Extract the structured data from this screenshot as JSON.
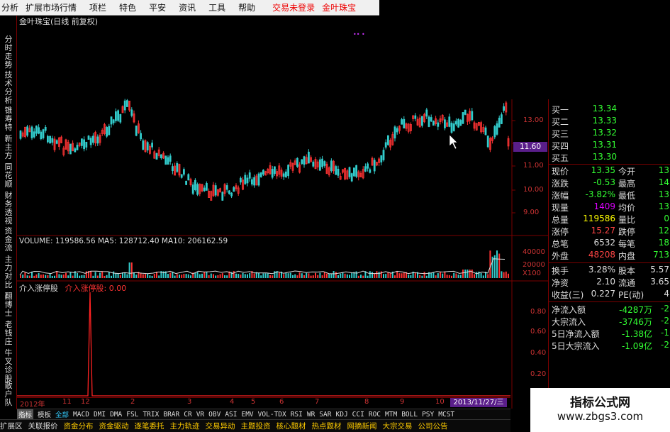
{
  "menu": {
    "items": [
      "分析",
      "扩展市场行情",
      "项栏",
      "特色",
      "平安",
      "资讯",
      "工具",
      "帮助"
    ],
    "login_status": "交易未登录",
    "stock_name": "金叶珠宝"
  },
  "chart": {
    "title": "金叶珠宝(日线 前复权)",
    "price_flag": "11.60",
    "price_ticks": [
      "13.00",
      "12.00",
      "11.00",
      "10.00",
      "9.00"
    ],
    "volume_label": "VOLUME: 119586.56  MA5: 128712.40  MA10: 206162.59",
    "volume_ticks": [
      "40000",
      "20000",
      "X100"
    ],
    "indicator_name": "介入涨停股",
    "indicator_value": "介入涨停股: 0.00",
    "indicator_ticks": [
      "0.80",
      "0.60",
      "0.40",
      "0.20"
    ],
    "date_badge": "2013/11/27/三",
    "x_ticks": [
      "2012年",
      "11",
      "12",
      "2",
      "3",
      "4",
      "5",
      "6",
      "7",
      "8",
      "9",
      "10",
      "11"
    ]
  },
  "left_tabs": [
    "分时走势",
    "技术分析",
    "锥寿特",
    "新主方",
    "同花顺",
    "财务透视",
    "资金流",
    "主力对比",
    "翻博士",
    "老钱庄",
    "牛叉诊股",
    "散户队"
  ],
  "quote": {
    "bids": [
      {
        "label": "买一",
        "value": "13.34"
      },
      {
        "label": "买二",
        "value": "13.33"
      },
      {
        "label": "买三",
        "value": "13.32"
      },
      {
        "label": "买四",
        "value": "13.31"
      },
      {
        "label": "买五",
        "value": "13.30"
      }
    ],
    "stats": [
      {
        "l1": "现价",
        "v1": "13.35",
        "c1": "#3f3",
        "l2": "今开",
        "v2": "13"
      },
      {
        "l1": "涨跌",
        "v1": "-0.53",
        "c1": "#3f3",
        "l2": "最高",
        "v2": "14"
      },
      {
        "l1": "涨幅",
        "v1": "-3.82%",
        "c1": "#3f3",
        "l2": "最低",
        "v2": "13"
      },
      {
        "l1": "现量",
        "v1": "1409",
        "c1": "#d0f",
        "l2": "均价",
        "v2": "13"
      },
      {
        "l1": "总量",
        "v1": "119586",
        "c1": "#ff0",
        "l2": "量比",
        "v2": "0"
      },
      {
        "l1": "涨停",
        "v1": "15.27",
        "c1": "#f44",
        "l2": "跌停",
        "v2": "12"
      },
      {
        "l1": "总笔",
        "v1": "6532",
        "c1": "#ddd",
        "l2": "每笔",
        "v2": "18"
      },
      {
        "l1": "外盘",
        "v1": "48208",
        "c1": "#f44",
        "l2": "内盘",
        "v2": "713"
      }
    ],
    "stats2": [
      {
        "l1": "换手",
        "v1": "3.28%",
        "c1": "#ddd",
        "l2": "股本",
        "v2": "5.57"
      },
      {
        "l1": "净资",
        "v1": "2.10",
        "c1": "#ddd",
        "l2": "流通",
        "v2": "3.65"
      },
      {
        "l1": "收益(三)",
        "v1": "0.227",
        "c1": "#ddd",
        "l2": "PE(动)",
        "v2": "4"
      }
    ],
    "flows": [
      {
        "label": "净流入额",
        "value": "-4287万",
        "extra": "-2"
      },
      {
        "label": "大宗流入",
        "value": "-3746万",
        "extra": "-2"
      },
      {
        "label": "5日净流入额",
        "value": "-1.38亿",
        "extra": "-1"
      },
      {
        "label": "5日大宗流入",
        "value": "-1.09亿",
        "extra": "-2"
      }
    ]
  },
  "index_bar": [
    "指标",
    "模板",
    "全部",
    "MACD",
    "DMI",
    "DMA",
    "FSL",
    "TRIX",
    "BRAR",
    "CR",
    "VR",
    "OBV",
    "ASI",
    "EMV",
    "VOL-TDX",
    "RSI",
    "WR",
    "SAR",
    "KDJ",
    "CCI",
    "ROC",
    "MTM",
    "BOLL",
    "PSY",
    "MCST"
  ],
  "bottom_tabs": [
    "扩展区",
    "关联报价",
    "资金分布",
    "资金驱动",
    "逐笔委托",
    "主力轨迹",
    "交易异动",
    "主题投资",
    "核心题材",
    "热点题材",
    "网摘新闻",
    "大宗交易",
    "公司公告"
  ],
  "watermark": {
    "line1": "指标公式网",
    "line2": "www.zbgs3.com"
  },
  "colors": {
    "up": "#ff3333",
    "down": "#33cccc",
    "axis": "#7a0000",
    "flag": "#5a1e8a"
  }
}
